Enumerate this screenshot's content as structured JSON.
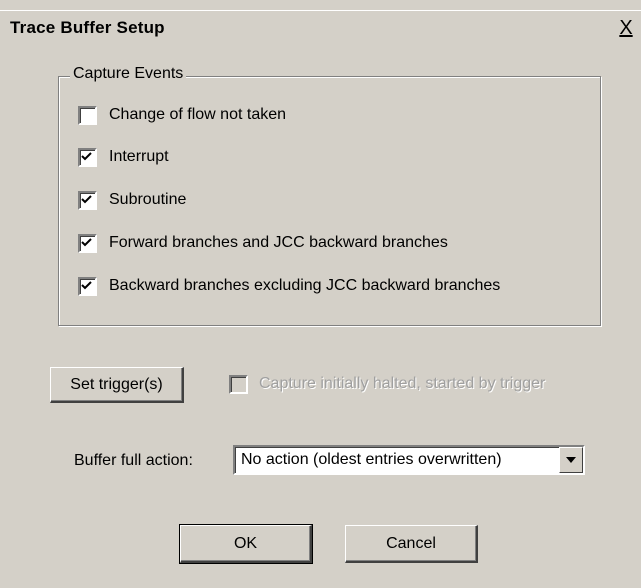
{
  "window": {
    "title": "Trace Buffer Setup",
    "close_glyph": "X"
  },
  "capture_events": {
    "legend": "Capture Events",
    "items": [
      {
        "label": "Change of flow not taken",
        "checked": false
      },
      {
        "label": "Interrupt",
        "checked": true
      },
      {
        "label": "Subroutine",
        "checked": true
      },
      {
        "label": "Forward branches and JCC backward branches",
        "checked": true
      },
      {
        "label": "Backward branches excluding JCC backward branches",
        "checked": true
      }
    ]
  },
  "trigger": {
    "button_label": "Set trigger(s)",
    "halted_label": "Capture initially halted, started by trigger",
    "halted_checked": false,
    "halted_enabled": false
  },
  "buffer": {
    "label": "Buffer full action:",
    "selected": "No action (oldest entries overwritten)"
  },
  "actions": {
    "ok_label": "OK",
    "cancel_label": "Cancel"
  },
  "icons": {
    "close": "close-icon",
    "check": "checkmark-icon",
    "dropdown": "dropdown-arrow-icon"
  }
}
